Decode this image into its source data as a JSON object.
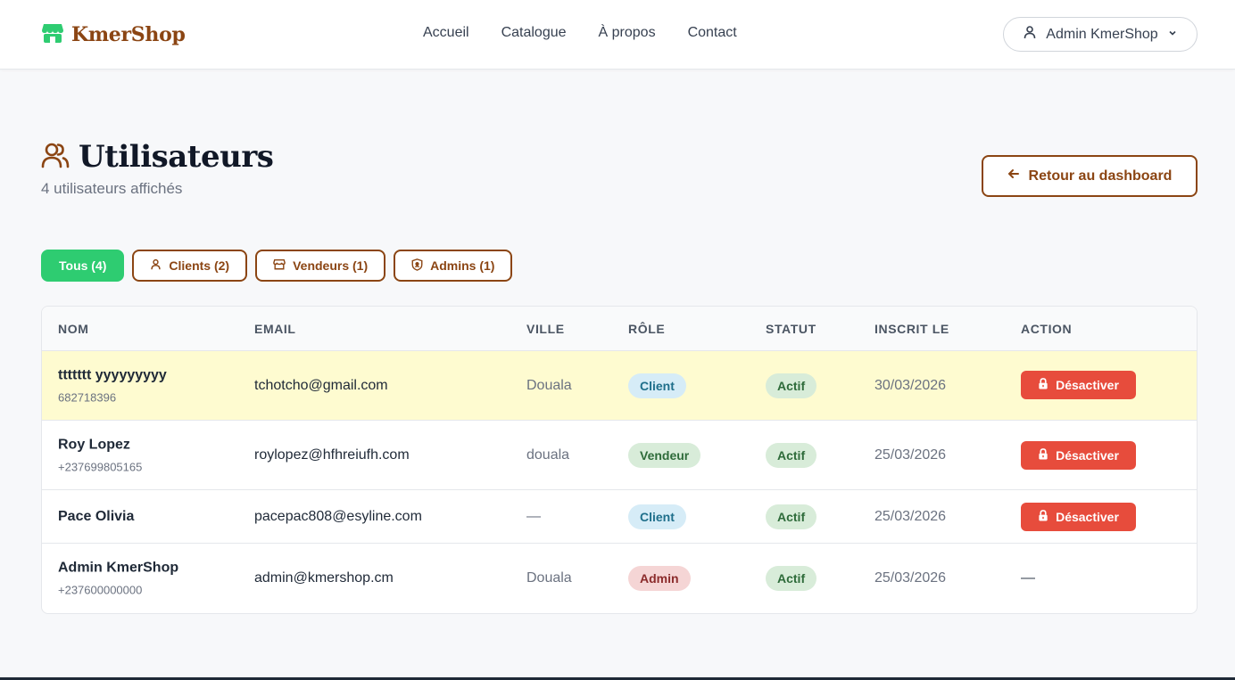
{
  "brand": {
    "name": "KmerShop",
    "color": "#8b4513"
  },
  "nav": {
    "links": [
      "Accueil",
      "Catalogue",
      "À propos",
      "Contact"
    ],
    "user_menu": {
      "label": "Admin KmerShop",
      "icon": "user-icon"
    }
  },
  "header": {
    "title": "Utilisateurs",
    "subtitle": "4 utilisateurs affichés",
    "back_button": "Retour au dashboard"
  },
  "filters": [
    {
      "label": "Tous (4)",
      "icon": "",
      "active": true
    },
    {
      "label": "Clients (2)",
      "icon": "user-icon",
      "active": false
    },
    {
      "label": "Vendeurs (1)",
      "icon": "store-icon",
      "active": false
    },
    {
      "label": "Admins (1)",
      "icon": "shield-icon",
      "active": false
    }
  ],
  "table": {
    "headers": [
      "NOM",
      "EMAIL",
      "VILLE",
      "RÔLE",
      "STATUT",
      "INSCRIT LE",
      "ACTION"
    ],
    "rows": [
      {
        "name": "ttttttt yyyyyyyyy",
        "phone": "682718396",
        "email": "tchotcho@gmail.com",
        "city": "Douala",
        "role": "Client",
        "status": "Actif",
        "date": "30/03/2026",
        "action": "Désactiver",
        "highlight": true
      },
      {
        "name": "Roy Lopez",
        "phone": "+237699805165",
        "email": "roylopez@hfhreiufh.com",
        "city": "douala",
        "role": "Vendeur",
        "status": "Actif",
        "date": "25/03/2026",
        "action": "Désactiver",
        "highlight": false
      },
      {
        "name": "Pace Olivia",
        "phone": "",
        "email": "pacepac808@esyline.com",
        "city": "—",
        "role": "Client",
        "status": "Actif",
        "date": "25/03/2026",
        "action": "Désactiver",
        "highlight": false
      },
      {
        "name": "Admin KmerShop",
        "phone": "+237600000000",
        "email": "admin@kmershop.cm",
        "city": "Douala",
        "role": "Admin",
        "status": "Actif",
        "date": "25/03/2026",
        "action": "—",
        "highlight": false
      }
    ]
  },
  "colors": {
    "accent_green": "#2ecc71",
    "brown": "#8b4513",
    "danger": "#e74c3c",
    "role_client_bg": "#d6ecf7",
    "role_client_fg": "#1f6f8b",
    "role_vendeur_bg": "#d8ecd9",
    "role_vendeur_fg": "#2e6b3a",
    "role_admin_bg": "#f5d5d5",
    "role_admin_fg": "#8b2b2b",
    "status_bg": "#d8ecd9",
    "status_fg": "#2e6b3a"
  }
}
